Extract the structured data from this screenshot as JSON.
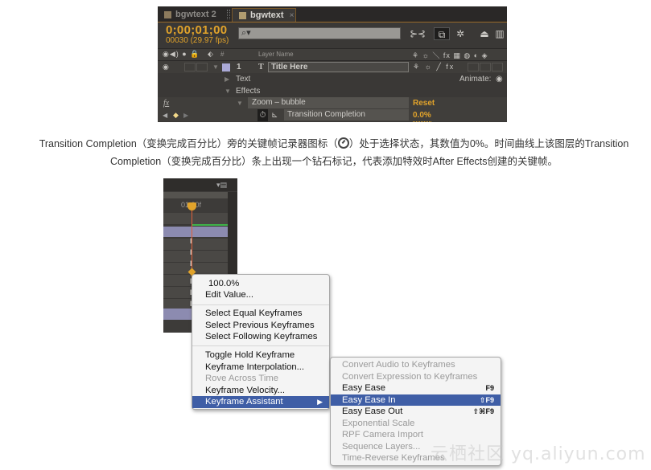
{
  "ae_panel": {
    "tabs": [
      {
        "label": "bgwtext 2",
        "active": false
      },
      {
        "label": "bgwtext",
        "active": true,
        "close": "×"
      }
    ],
    "timecode": "0;00;01;00",
    "frames": "00030 (29.97 fps)",
    "search": {
      "icon": "search-icon",
      "value": ""
    },
    "toolbar_icons": [
      "composition-mini-flowchart-icon",
      "draft-3d-icon",
      "hide-shy-layers-icon",
      "frame-blending-icon",
      "motion-blur-icon",
      "graph-editor-icon"
    ],
    "header": {
      "switches": "👁 🔊 ● 🔒",
      "label_col": "#",
      "layer_name_col": "Layer Name",
      "switch_icons": "⚘ ☼ ＼ fx ▦ ◍ ◐ ◈"
    },
    "layer": {
      "number": "1",
      "type_icon": "T",
      "name": "Title Here",
      "label_color": "#aaa9d6",
      "switches": "⚘ ☼ ╱ fx"
    },
    "rows": {
      "text": "Text",
      "animate": "Animate:",
      "effects": "Effects",
      "effect_name": "Zoom – bubble",
      "reset": "Reset",
      "property": "Transition Completion",
      "property_value": "0.0%"
    }
  },
  "caption": {
    "line1_a": "Transition Completion（变换完成百分比）旁的关键帧记录器图标（",
    "line1_b": "）处于选择状态，其数值为0%。时间曲线上该图层的Transition",
    "line2": "Completion（变换完成百分比）条上出现一个钻石标记，代表添加特效时After Effects创建的关键帧。"
  },
  "timeline": {
    "time_label": "01:00f"
  },
  "context_menu": {
    "items": [
      {
        "label": "100.0%",
        "enabled": false,
        "type": "value"
      },
      {
        "label": "Edit Value...",
        "enabled": true
      },
      {
        "label": "Select Equal Keyframes",
        "enabled": true
      },
      {
        "label": "Select Previous Keyframes",
        "enabled": true
      },
      {
        "label": "Select Following Keyframes",
        "enabled": true
      },
      {
        "label": "Toggle Hold Keyframe",
        "enabled": true
      },
      {
        "label": "Keyframe Interpolation...",
        "enabled": true
      },
      {
        "label": "Rove Across Time",
        "enabled": false
      },
      {
        "label": "Keyframe Velocity...",
        "enabled": true
      },
      {
        "label": "Keyframe Assistant",
        "enabled": true,
        "highlighted": true,
        "submenu": true
      }
    ]
  },
  "submenu": {
    "items": [
      {
        "label": "Convert Audio to Keyframes",
        "enabled": false,
        "shortcut": ""
      },
      {
        "label": "Convert Expression to Keyframes",
        "enabled": false,
        "shortcut": ""
      },
      {
        "label": "Easy Ease",
        "enabled": true,
        "shortcut": "F9"
      },
      {
        "label": "Easy Ease In",
        "enabled": true,
        "highlighted": true,
        "shortcut": "⇧F9"
      },
      {
        "label": "Easy Ease Out",
        "enabled": true,
        "shortcut": "⇧⌘F9"
      },
      {
        "label": "Exponential Scale",
        "enabled": false,
        "shortcut": ""
      },
      {
        "label": "RPF Camera Import",
        "enabled": false,
        "shortcut": ""
      },
      {
        "label": "Sequence Layers...",
        "enabled": false,
        "shortcut": ""
      },
      {
        "label": "Time-Reverse Keyframes",
        "enabled": false,
        "shortcut": ""
      }
    ]
  },
  "watermark": "云栖社区 yq.aliyun.com",
  "colors": {
    "accent_orange": "#e1a32b",
    "menu_highlight": "#3f5ea6",
    "panel_bg": "#3a3836"
  }
}
